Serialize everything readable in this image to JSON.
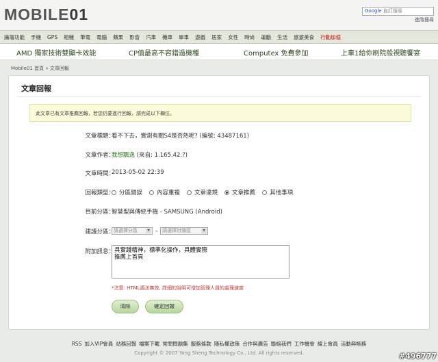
{
  "header": {
    "logo_text": "MOBILE",
    "logo_suffix": "01",
    "search_brand": "Google",
    "search_placeholder": "自訂搜尋",
    "login_link": "進階搜尋"
  },
  "nav": [
    "論壇功能",
    "手機",
    "GPS",
    "相機",
    "筆電",
    "電腦",
    "蘋果",
    "影音",
    "汽車",
    "機車",
    "單車",
    "遊戲",
    "居家",
    "女性",
    "時尚",
    "運動",
    "生活",
    "旅遊美食",
    "行動加值"
  ],
  "promo": [
    "AMD 獨家技術雙顯卡效能",
    "CP值最高不容錯過機種",
    "Computex 免費參加",
    "上車1給你刷院般視聽饗宴"
  ],
  "breadcrumb": "Mobile01 首頁 » 文章回報",
  "panel": {
    "title": "文章回報",
    "notice": "此文章已有文章推薦回報，若您仍要進行回報，請完成以下欄位。",
    "fields": {
      "subject_label": "文章標題：",
      "subject_value": "看不下去，實測有關S4是否熱呢? (編號: 43487161)",
      "author_label": "文章作者：",
      "author_name": "我想飄逸",
      "author_ip": "(來自: 1.165.42.?)",
      "time_label": "文章時間：",
      "time_value": "2013-05-02 22:39",
      "type_label": "回報類型：",
      "type_options": [
        "分區錯誤",
        "內容重複",
        "文章違規",
        "文章推薦",
        "其他事項"
      ],
      "type_selected": "文章推薦",
      "forum_label": "目前分區：",
      "forum_value": "智慧型與傳統手機 - SAMSUNG (Android)",
      "suggest_label": "建議分區：",
      "suggest_select1": "請選擇分區",
      "suggest_select2": "請選擇討論區",
      "message_label": "附加訊息：",
      "message_value": "具實踐精神，標準化操作，具體實際\n推薦上首頁",
      "warning": "*注意: HTML語法無效, 詳細的說明可增加管理人員的處理速度"
    },
    "buttons": {
      "clear": "清除",
      "submit": "確定回報"
    }
  },
  "footer": {
    "links": [
      "RSS",
      "加入VIP會員",
      "站務回報",
      "檔案下載",
      "常問問題集",
      "服務條款",
      "隱私權政策",
      "合作與廣告",
      "聯絡我們",
      "工作機會",
      "線上會員",
      "活動與帳務"
    ],
    "copyright": "Copyright © 2007 Yong Sheng Technology Co., Ltd. All rights reserved.",
    "watermark": "#496777"
  }
}
